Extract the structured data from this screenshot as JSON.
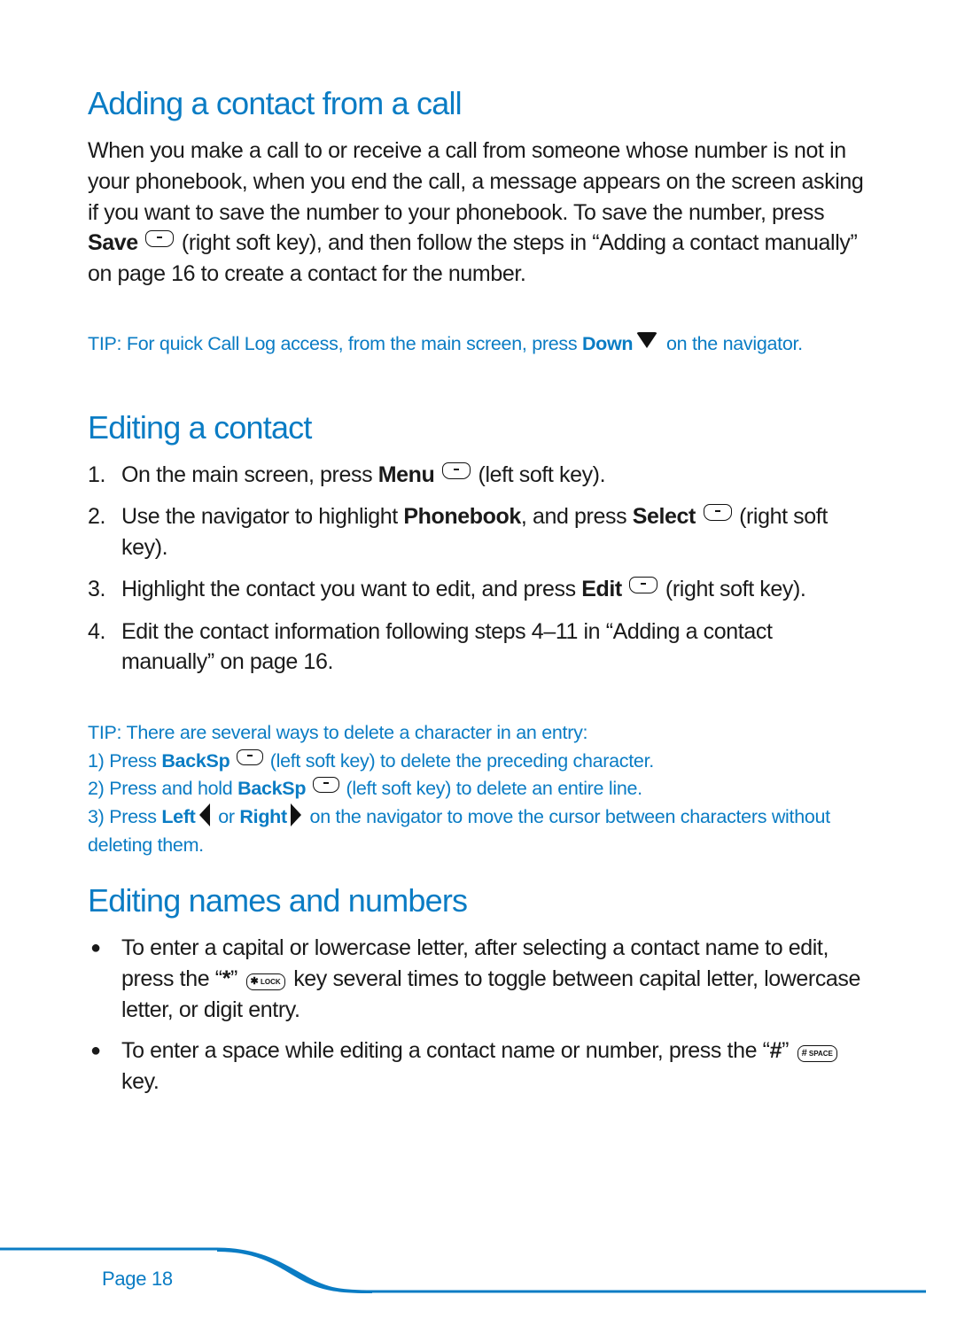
{
  "sections": [
    {
      "title": "Adding a contact from a call",
      "paragraph": {
        "part1": "When you make a call to or receive a call from someone whose number is not in your phonebook, when you end the call, a message appears on the screen asking if you want to save the number to your phonebook. To save the number, press ",
        "bold1": "Save",
        "part2": " (right soft key), and then follow the steps in “Adding a contact manually” on page 16 to create a contact for the number."
      },
      "tip": {
        "label": "TIP:",
        "text1": " For quick Call Log access, from the main screen, press ",
        "bold1": "Down",
        "text2": " on the navigator."
      }
    },
    {
      "title": "Editing a contact",
      "steps": [
        {
          "num": "1.",
          "t1": "On the main screen, press ",
          "b1": "Menu",
          "t2": " (left soft key)."
        },
        {
          "num": "2.",
          "t1": "Use the navigator to highlight ",
          "b1": "Phonebook",
          "t2": ", and press ",
          "b2": "Select",
          "t3": " (right soft key)."
        },
        {
          "num": "3.",
          "t1": "Highlight the contact you want to edit, and press ",
          "b1": "Edit",
          "t2": " (right soft key)."
        },
        {
          "num": "4.",
          "t1": "Edit the contact information following steps 4–11 in “Adding a contact manually” on page 16."
        }
      ],
      "tip": {
        "label": "TIP:",
        "intro": " There are several ways to delete a character in an entry:",
        "line1": {
          "t1": "1) Press ",
          "b1": "BackSp",
          "t2": " (left soft key) to delete the preceding character."
        },
        "line2": {
          "t1": "2) Press and hold ",
          "b1": "BackSp",
          "t2": " (left soft key) to delete an entire line."
        },
        "line3": {
          "t1": "3) Press ",
          "b1": "Left",
          "t2": " or ",
          "b2": "Right",
          "t3": " on the navigator to move the cursor between characters without deleting them."
        }
      }
    },
    {
      "title": "Editing names and numbers",
      "bullets": [
        {
          "t1": "To enter a capital or lowercase letter, after selecting a contact name to edit, press the “",
          "b1": "*",
          "t2": "”",
          "key_sym": "✱",
          "key_label": "LOCK",
          "t3": " key several times to toggle between capital letter, lowercase letter, or digit entry."
        },
        {
          "t1": "To enter a space while editing a contact name or number, press the “",
          "b1": "#",
          "t2": "”",
          "key_sym": "#",
          "key_label": "SPACE",
          "t3": " key."
        }
      ]
    }
  ],
  "footer": {
    "page_label": "Page 18",
    "accent_color": "#0a7cc4"
  },
  "icons": {
    "soft_key": "soft-key-icon",
    "nav_down": "navigator-down-icon",
    "nav_left": "navigator-left-icon",
    "nav_right": "navigator-right-icon",
    "star_key": "star-lock-key-icon",
    "hash_key": "hash-space-key-icon"
  }
}
